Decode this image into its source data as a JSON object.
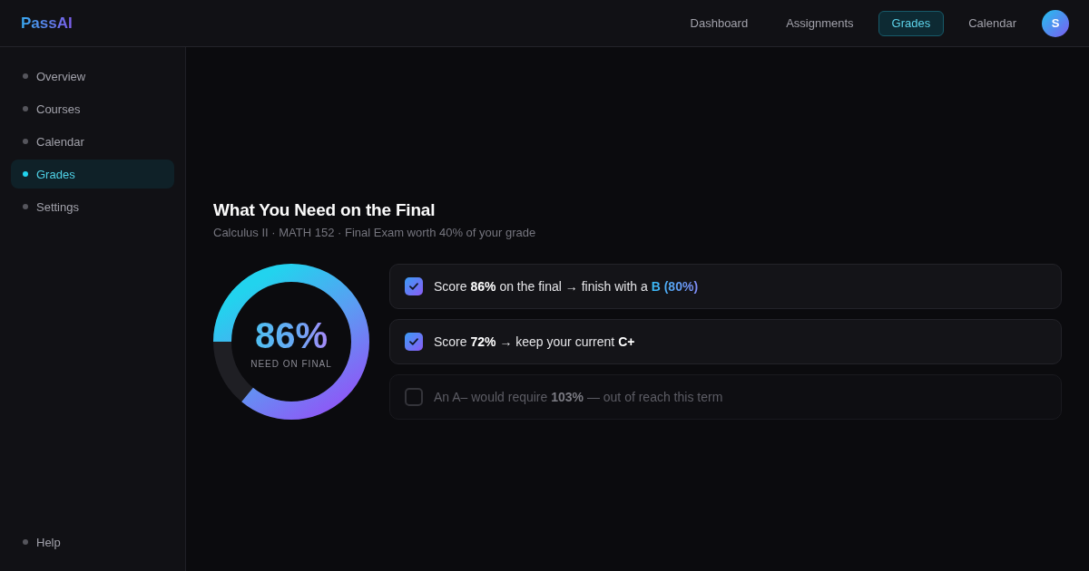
{
  "header": {
    "logo": "PassAI",
    "tabs": [
      {
        "label": "Dashboard",
        "selected": false
      },
      {
        "label": "Assignments",
        "selected": false
      },
      {
        "label": "Grades",
        "selected": true
      },
      {
        "label": "Calendar",
        "selected": false
      }
    ],
    "avatar": "S"
  },
  "sidebar": {
    "items": [
      {
        "label": "Overview",
        "selected": false
      },
      {
        "label": "Courses",
        "selected": false
      },
      {
        "label": "Calendar",
        "selected": false
      },
      {
        "label": "Grades",
        "selected": true
      },
      {
        "label": "Settings",
        "selected": false
      }
    ],
    "bottom_items": [
      {
        "label": "Help",
        "selected": false
      }
    ]
  },
  "main": {
    "title": "What You Need on the Final",
    "subtitle": "Calculus II · MATH 152 · Final Exam worth 40% of your grade",
    "ring": {
      "level": 0.86,
      "value": "86%",
      "caption": "NEED ON FINAL"
    },
    "scenarios": [
      {
        "checked": true,
        "text": "Score **86%** on the final → finish with a",
        "highlight": "B (80%)"
      },
      {
        "checked": true,
        "text": "Score **72%** → keep your current **C+**"
      },
      {
        "checked": false,
        "text": "An A– would require **103%** — out of reach this term"
      }
    ]
  }
}
